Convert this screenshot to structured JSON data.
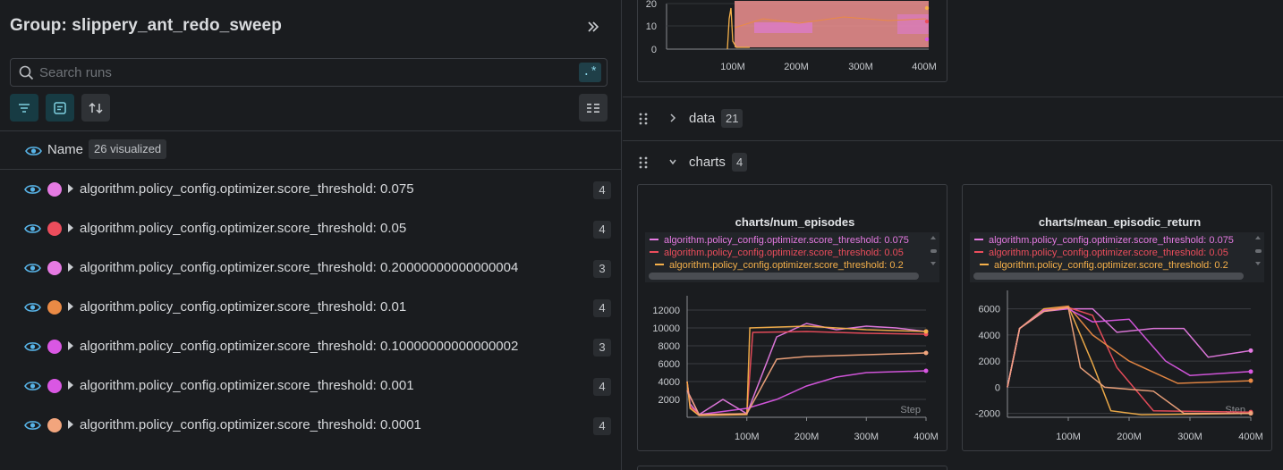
{
  "sidebar": {
    "group_title": "Group: slippery_ant_redo_sweep",
    "search_placeholder": "Search runs",
    "regex_label": ".*",
    "name_header": "Name",
    "visualized_badge": "26 visualized",
    "runs": [
      {
        "label": "algorithm.policy_config.optimizer.score_threshold: 0.075",
        "count": "4",
        "color": "#e57ae2"
      },
      {
        "label": "algorithm.policy_config.optimizer.score_threshold: 0.05",
        "count": "4",
        "color": "#ec4d5c"
      },
      {
        "label": "algorithm.policy_config.optimizer.score_threshold: 0.20000000000000004",
        "count": "3",
        "color": "#e57ae2"
      },
      {
        "label": "algorithm.policy_config.optimizer.score_threshold: 0.01",
        "count": "4",
        "color": "#ea8a45"
      },
      {
        "label": "algorithm.policy_config.optimizer.score_threshold: 0.10000000000000002",
        "count": "3",
        "color": "#d957e3"
      },
      {
        "label": "algorithm.policy_config.optimizer.score_threshold: 0.001",
        "count": "4",
        "color": "#d957e3"
      },
      {
        "label": "algorithm.policy_config.optimizer.score_threshold: 0.0001",
        "count": "4",
        "color": "#f2a57d"
      }
    ]
  },
  "sections": {
    "data": {
      "title": "data",
      "count": "21"
    },
    "charts": {
      "title": "charts",
      "count": "4"
    }
  },
  "top_chart": {
    "y_ticks": [
      "20",
      "10",
      "0"
    ],
    "x_ticks": [
      "100M",
      "200M",
      "300M",
      "400M"
    ]
  },
  "chart_data": [
    {
      "type": "line",
      "title": "charts/num_episodes",
      "legend": [
        {
          "name": "algorithm.policy_config.optimizer.score_threshold: 0.075",
          "color": "#e57ae2"
        },
        {
          "name": "algorithm.policy_config.optimizer.score_threshold: 0.05",
          "color": "#ec4d5c"
        },
        {
          "name": "algorithm.policy_config.optimizer.score_threshold: 0.2",
          "color": "#f5b04a"
        }
      ],
      "x_ticks": [
        "100M",
        "200M",
        "300M",
        "400M"
      ],
      "y_ticks": [
        "12000",
        "10000",
        "8000",
        "6000",
        "4000",
        "2000"
      ],
      "xlim": [
        0,
        400000000
      ],
      "ylim": [
        0,
        13000
      ],
      "xlabel_inline": "Step",
      "series": [
        {
          "name": "algorithm.policy_config.optimizer.score_threshold: 0.075",
          "color": "#e57ae2",
          "x": [
            0,
            5000000,
            20000000,
            60000000,
            100000000,
            150000000,
            200000000,
            250000000,
            300000000,
            350000000,
            400000000
          ],
          "y": [
            4000,
            1500,
            300,
            2000,
            400,
            9000,
            10500,
            9800,
            10200,
            10000,
            9600
          ]
        },
        {
          "name": "algorithm.policy_config.optimizer.score_threshold: 0.05",
          "color": "#ec4d5c",
          "x": [
            0,
            5000000,
            20000000,
            100000000,
            110000000,
            200000000,
            300000000,
            400000000
          ],
          "y": [
            4000,
            1200,
            300,
            400,
            9500,
            9600,
            9400,
            9300
          ]
        },
        {
          "name": "algorithm.policy_config.optimizer.score_threshold: 0.2",
          "color": "#f5b04a",
          "x": [
            0,
            5000000,
            20000000,
            100000000,
            105000000,
            200000000,
            300000000,
            400000000
          ],
          "y": [
            4000,
            1000,
            200,
            300,
            10000,
            10200,
            9800,
            9600
          ]
        },
        {
          "name": "",
          "color": "#d957e3",
          "x": [
            0,
            20000000,
            100000000,
            150000000,
            200000000,
            250000000,
            300000000,
            400000000
          ],
          "y": [
            3000,
            300,
            1000,
            2000,
            3500,
            4500,
            5000,
            5200
          ]
        },
        {
          "name": "",
          "color": "#f2a57d",
          "x": [
            0,
            20000000,
            100000000,
            150000000,
            200000000,
            300000000,
            400000000
          ],
          "y": [
            3000,
            300,
            400,
            6500,
            6800,
            7000,
            7200
          ]
        }
      ]
    },
    {
      "type": "line",
      "title": "charts/mean_episodic_return",
      "legend": [
        {
          "name": "algorithm.policy_config.optimizer.score_threshold: 0.075",
          "color": "#e57ae2"
        },
        {
          "name": "algorithm.policy_config.optimizer.score_threshold: 0.05",
          "color": "#ec4d5c"
        },
        {
          "name": "algorithm.policy_config.optimizer.score_threshold: 0.2",
          "color": "#f5b04a"
        }
      ],
      "x_ticks": [
        "100M",
        "200M",
        "300M",
        "400M"
      ],
      "y_ticks": [
        "6000",
        "4000",
        "2000",
        "0",
        "-2000"
      ],
      "xlim": [
        0,
        400000000
      ],
      "ylim": [
        -2300,
        7000
      ],
      "xlabel_inline": "Step",
      "series": [
        {
          "name": "algorithm.policy_config.optimizer.score_threshold: 0.075",
          "color": "#e57ae2",
          "x": [
            0,
            20000000,
            60000000,
            100000000,
            140000000,
            180000000,
            240000000,
            290000000,
            330000000,
            400000000
          ],
          "y": [
            0,
            4500,
            5800,
            6000,
            6000,
            4200,
            4500,
            4500,
            2300,
            2800
          ]
        },
        {
          "name": "algorithm.policy_config.optimizer.score_threshold: 0.05",
          "color": "#ec4d5c",
          "x": [
            0,
            20000000,
            60000000,
            100000000,
            140000000,
            180000000,
            240000000,
            400000000
          ],
          "y": [
            0,
            4500,
            5900,
            6100,
            5500,
            1500,
            -1800,
            -1900
          ]
        },
        {
          "name": "algorithm.policy_config.optimizer.score_threshold: 0.2",
          "color": "#f5b04a",
          "x": [
            0,
            20000000,
            60000000,
            100000000,
            140000000,
            170000000,
            220000000,
            400000000
          ],
          "y": [
            0,
            4500,
            6000,
            6200,
            1800,
            -1800,
            -2100,
            -2000
          ]
        },
        {
          "name": "",
          "color": "#ea8a45",
          "x": [
            0,
            20000000,
            60000000,
            100000000,
            140000000,
            200000000,
            280000000,
            400000000
          ],
          "y": [
            0,
            4500,
            5900,
            6200,
            4000,
            2000,
            300,
            500
          ]
        },
        {
          "name": "",
          "color": "#d957e3",
          "x": [
            0,
            20000000,
            60000000,
            100000000,
            140000000,
            200000000,
            260000000,
            300000000,
            400000000
          ],
          "y": [
            0,
            4500,
            5900,
            6000,
            5000,
            5200,
            2000,
            900,
            1200
          ]
        },
        {
          "name": "",
          "color": "#f2a57d",
          "x": [
            0,
            20000000,
            60000000,
            100000000,
            120000000,
            160000000,
            240000000,
            290000000,
            400000000
          ],
          "y": [
            0,
            4500,
            5800,
            6100,
            1500,
            0,
            -300,
            -2000,
            -2000
          ]
        }
      ]
    }
  ]
}
